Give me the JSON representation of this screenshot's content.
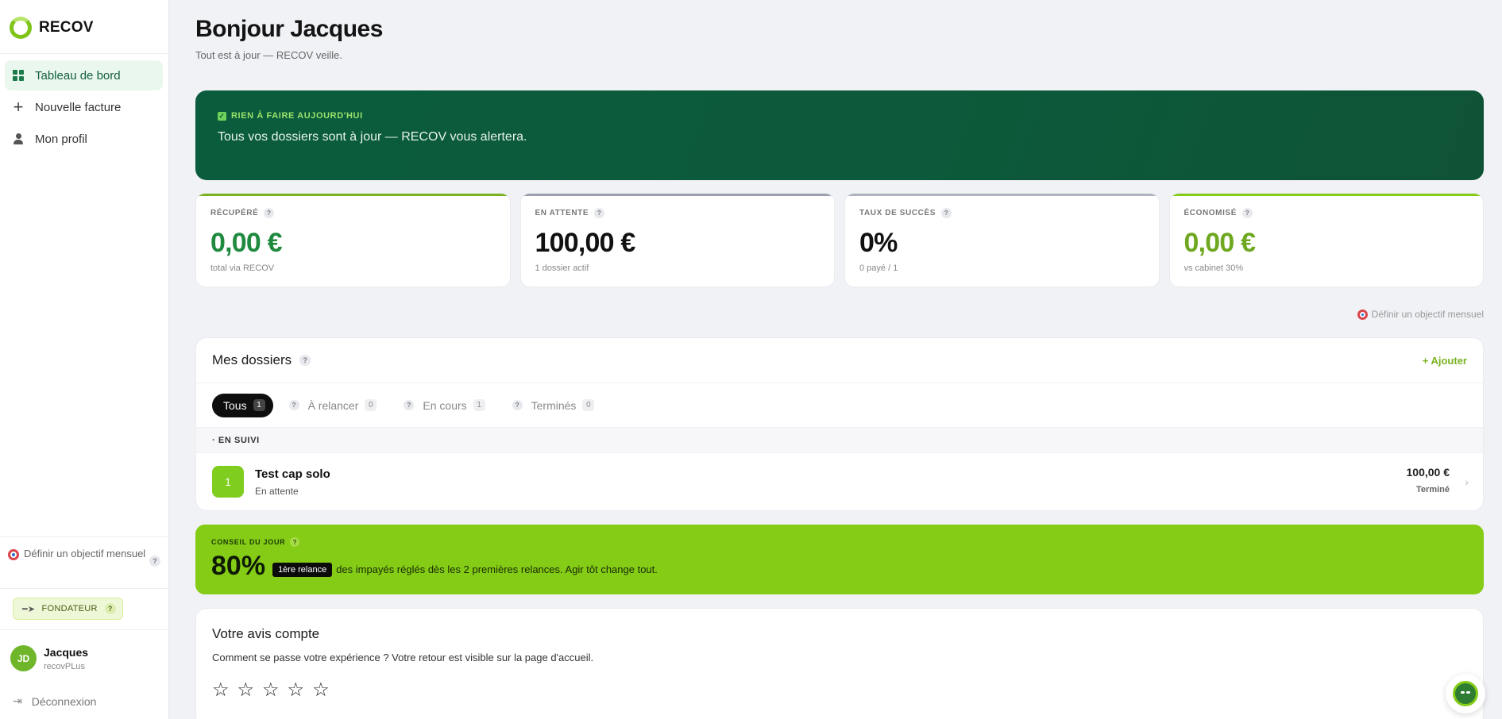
{
  "brand": {
    "name": "RECOV"
  },
  "sidebar": {
    "items": [
      {
        "label": "Tableau de bord",
        "icon": "grid-icon",
        "active": true
      },
      {
        "label": "Nouvelle facture",
        "icon": "plus-icon"
      },
      {
        "label": "Mon profil",
        "icon": "user-icon"
      }
    ],
    "goal": "Définir un objectif mensuel",
    "founder_badge": "FONDATEUR",
    "user": {
      "initials": "JD",
      "name": "Jacques",
      "plan": "recovPLus"
    },
    "logout": "Déconnexion"
  },
  "header": {
    "greeting": "Bonjour Jacques",
    "subtitle": "Tout est à jour — RECOV veille."
  },
  "hero": {
    "tag": "RIEN À FAIRE AUJOURD'HUI",
    "text": "Tous vos dossiers sont à jour — RECOV vous alertera."
  },
  "stats": [
    {
      "label": "RÉCUPÉRÉ",
      "value": "0,00 €",
      "sub": "total via RECOV",
      "color": "#1f8a3e",
      "bar": "#79b320"
    },
    {
      "label": "EN ATTENTE",
      "value": "100,00 €",
      "sub": "1 dossier actif",
      "color": "#111111",
      "bar": "#9aa0ad"
    },
    {
      "label": "TAUX DE SUCCÈS",
      "value": "0%",
      "sub": "0 payé / 1",
      "color": "#111111",
      "bar": "#b0b4c0"
    },
    {
      "label": "ÉCONOMISÉ",
      "value": "0,00 €",
      "sub": "vs cabinet 30%",
      "color": "#6ea821",
      "bar": "#84cc16"
    }
  ],
  "goal_link": "Définir un objectif mensuel",
  "dossiers": {
    "title": "Mes dossiers",
    "add_label": "+ Ajouter",
    "tabs": [
      {
        "label": "Tous",
        "count": "1",
        "active": true
      },
      {
        "label": "À relancer",
        "count": "0"
      },
      {
        "label": "En cours",
        "count": "1"
      },
      {
        "label": "Terminés",
        "count": "0"
      }
    ],
    "section": "· EN SUIVI",
    "rows": [
      {
        "num": "1",
        "title": "Test cap solo",
        "status": "En attente",
        "amount": "100,00 €",
        "state": "Terminé"
      }
    ]
  },
  "tip": {
    "tag": "CONSEIL DU JOUR",
    "big": "80%",
    "badge": "1ère relance",
    "text": "des impayés réglés dès les 2 premières relances. Agir tôt change tout."
  },
  "feedback": {
    "title": "Votre avis compte",
    "subtitle": "Comment se passe votre expérience ? Votre retour est visible sur la page d'accueil.",
    "stars": [
      "☆",
      "☆",
      "☆",
      "☆",
      "☆"
    ]
  }
}
